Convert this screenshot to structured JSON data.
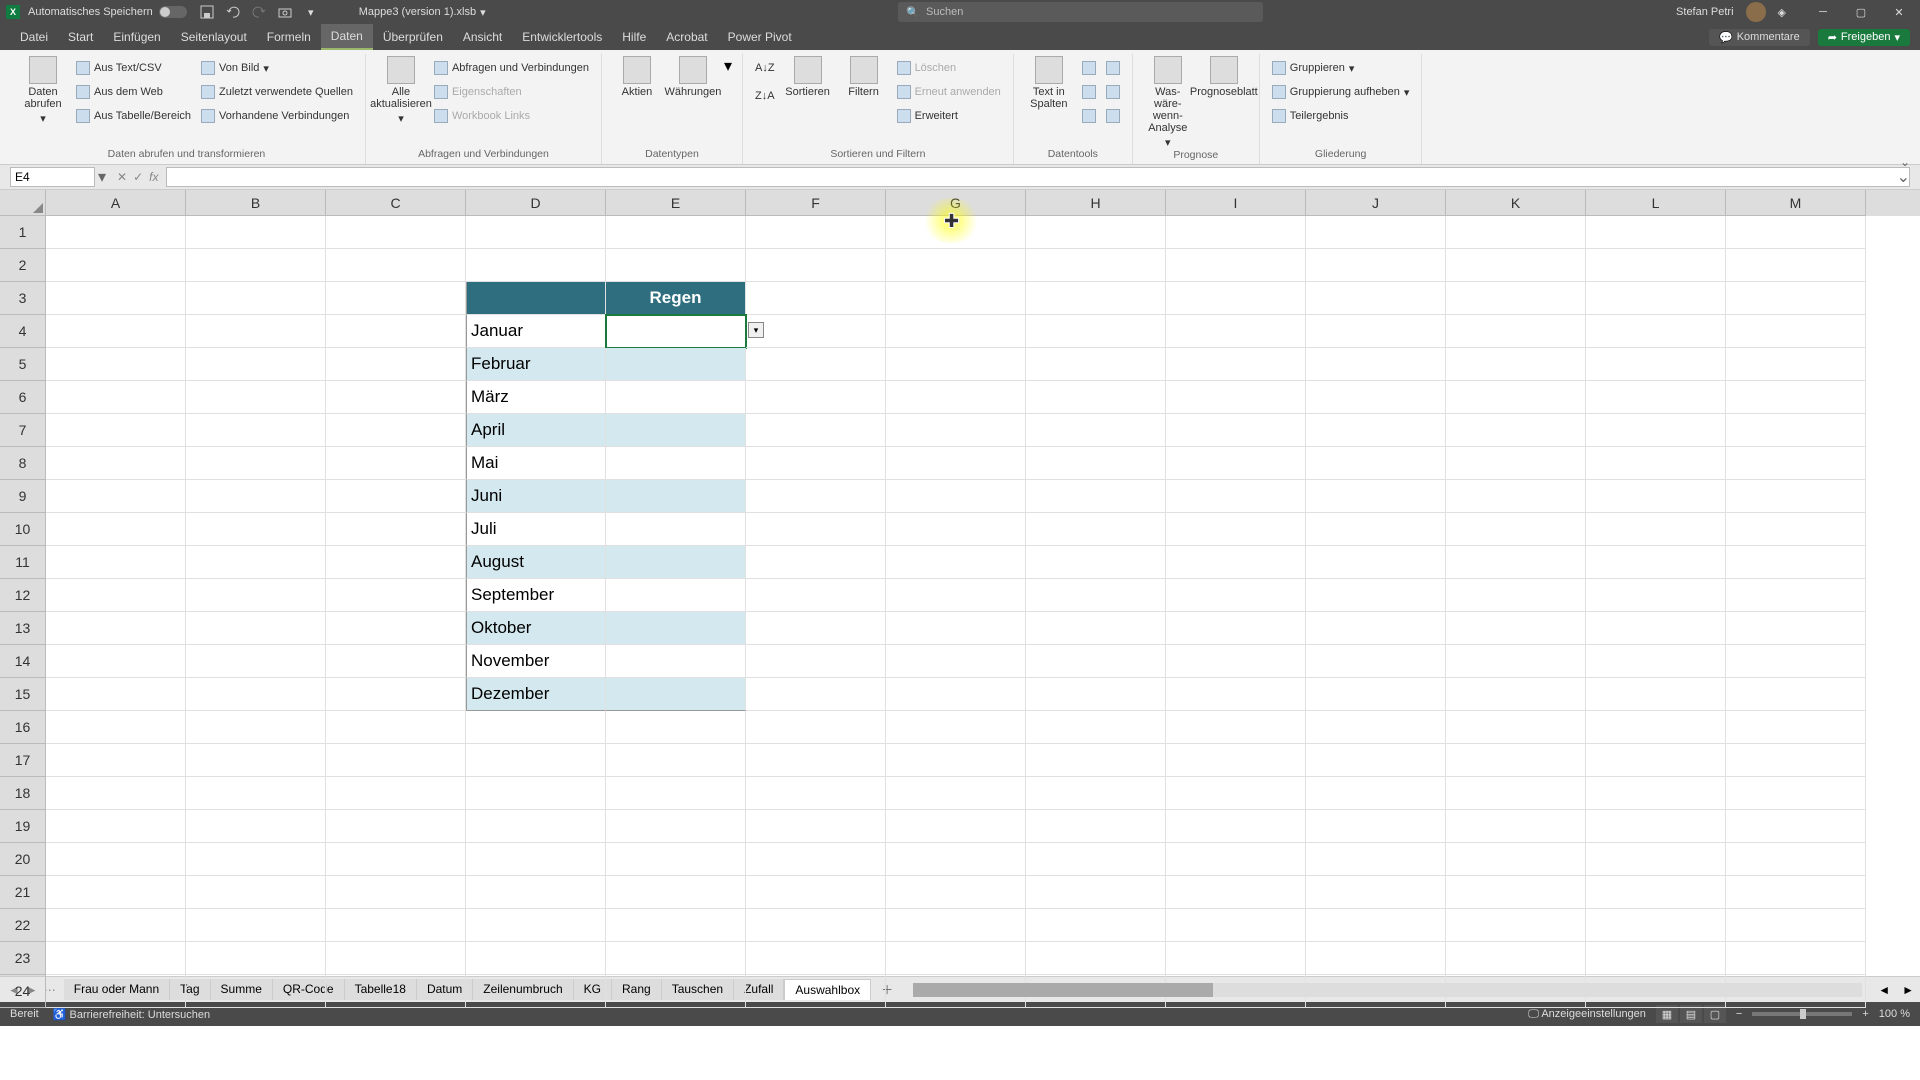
{
  "title": {
    "autosave": "Automatisches Speichern",
    "filename": "Mappe3 (version 1).xlsb",
    "search_placeholder": "Suchen",
    "user": "Stefan Petri"
  },
  "tabs": [
    "Datei",
    "Start",
    "Einfügen",
    "Seitenlayout",
    "Formeln",
    "Daten",
    "Überprüfen",
    "Ansicht",
    "Entwicklertools",
    "Hilfe",
    "Acrobat",
    "Power Pivot"
  ],
  "active_tab": "Daten",
  "ribbon_right": {
    "comments": "Kommentare",
    "share": "Freigeben"
  },
  "ribbon": {
    "group1": {
      "big": "Daten abrufen",
      "items": [
        "Aus Text/CSV",
        "Aus dem Web",
        "Aus Tabelle/Bereich",
        "Von Bild",
        "Zuletzt verwendete Quellen",
        "Vorhandene Verbindungen"
      ],
      "label": "Daten abrufen und transformieren"
    },
    "group2": {
      "big": "Alle aktualisieren",
      "items": [
        "Abfragen und Verbindungen",
        "Eigenschaften",
        "Workbook Links"
      ],
      "label": "Abfragen und Verbindungen"
    },
    "group3": {
      "items": [
        "Aktien",
        "Währungen"
      ],
      "label": "Datentypen"
    },
    "group4": {
      "sort": "Sortieren",
      "filter": "Filtern",
      "items": [
        "Löschen",
        "Erneut anwenden",
        "Erweitert"
      ],
      "label": "Sortieren und Filtern"
    },
    "group5": {
      "big": "Text in Spalten",
      "label": "Datentools"
    },
    "group6": {
      "items": [
        "Was-wäre-wenn-Analyse",
        "Prognoseblatt"
      ],
      "label": "Prognose"
    },
    "group7": {
      "items": [
        "Gruppieren",
        "Gruppierung aufheben",
        "Teilergebnis"
      ],
      "label": "Gliederung"
    }
  },
  "namebox": "E4",
  "columns": [
    "A",
    "B",
    "C",
    "D",
    "E",
    "F",
    "G",
    "H",
    "I",
    "J",
    "K",
    "L",
    "M"
  ],
  "rows": [
    "1",
    "2",
    "3",
    "4",
    "5",
    "6",
    "7",
    "8",
    "9",
    "10",
    "11",
    "12",
    "13",
    "14",
    "15",
    "16",
    "17",
    "18",
    "19",
    "20",
    "21",
    "22",
    "23",
    "24"
  ],
  "table": {
    "header": "Regen",
    "months": [
      "Januar",
      "Februar",
      "März",
      "April",
      "Mai",
      "Juni",
      "Juli",
      "August",
      "September",
      "Oktober",
      "November",
      "Dezember"
    ]
  },
  "sheets": [
    "Frau oder Mann",
    "Tag",
    "Summe",
    "QR-Code",
    "Tabelle18",
    "Datum",
    "Zeilenumbruch",
    "KG",
    "Rang",
    "Tauschen",
    "Zufall",
    "Auswahlbox"
  ],
  "active_sheet": "Auswahlbox",
  "status": {
    "ready": "Bereit",
    "accessibility": "Barrierefreiheit: Untersuchen",
    "display": "Anzeigeeinstellungen",
    "zoom": "100 %"
  }
}
